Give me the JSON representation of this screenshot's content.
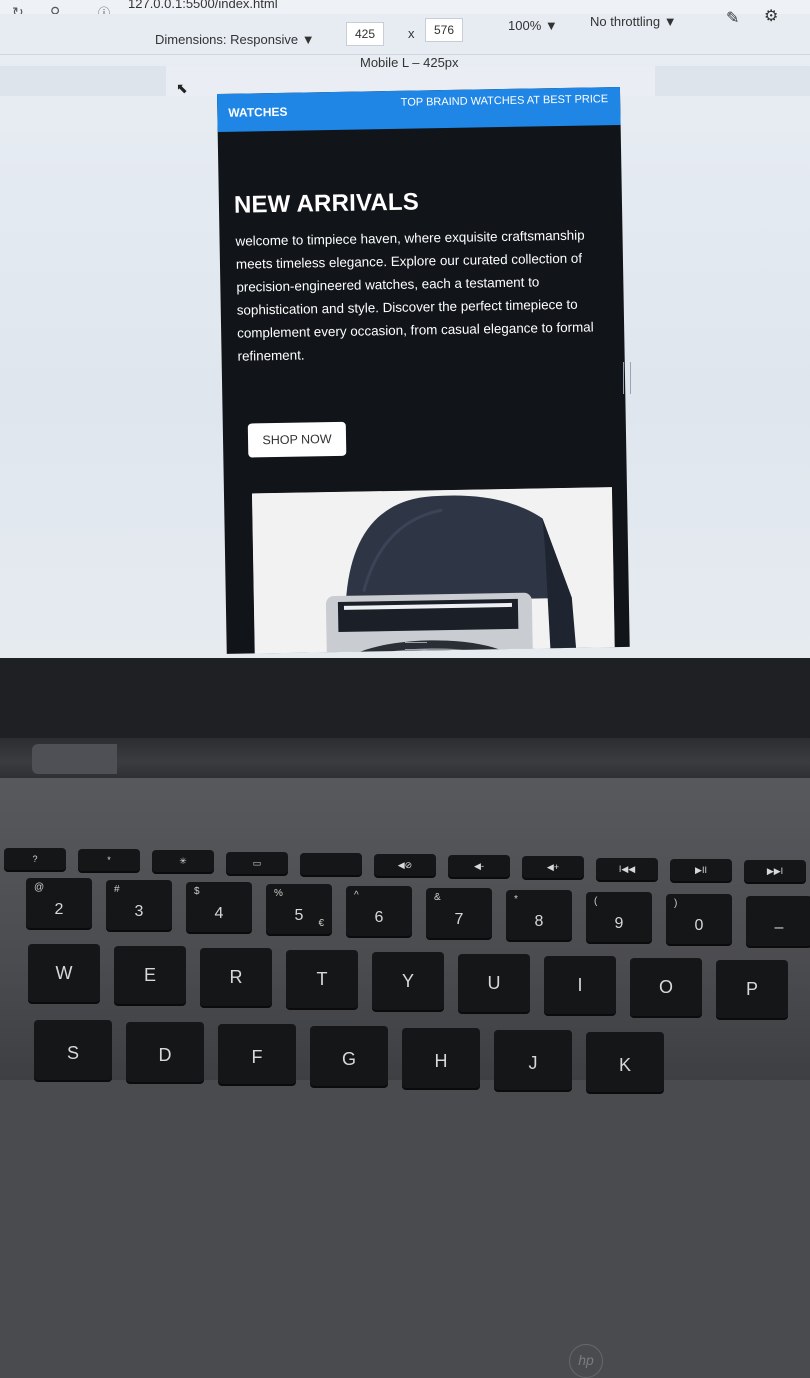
{
  "browser": {
    "url": "127.0.0.1:5500/index.html",
    "dimensions_label": "Dimensions: Responsive",
    "width_value": "425",
    "times": "x",
    "height_value": "576",
    "zoom": "100%",
    "throttling": "No throttling",
    "ruler_label": "Mobile L – 425px"
  },
  "site": {
    "brand": "WATCHES",
    "nav_link": "TOP BRAIND WATCHES AT BEST PRICE",
    "hero_title": "NEW ARRIVALS",
    "hero_text": "welcome to timpiece haven, where exquisite craftsmanship meets timeless elegance. Explore our curated collection of precision-engineered watches, each a testament to sophistication and style. Discover the perfect timepiece to complement every occasion, from casual elegance to formal refinement.",
    "cta_label": "SHOP NOW",
    "accent_color": "#1f86e6",
    "background_color": "#111418"
  },
  "laptop": {
    "logo": "hp",
    "fn_keys": [
      "?",
      "*",
      "✳",
      "▭",
      "",
      "◀⊘",
      "◀-",
      "◀+",
      "I◀◀",
      "▶II",
      "▶▶I"
    ],
    "num_row": [
      {
        "main": "2",
        "top": "@"
      },
      {
        "main": "3",
        "top": "#"
      },
      {
        "main": "4",
        "top": "$"
      },
      {
        "main": "5",
        "top": "%",
        "alt": "€"
      },
      {
        "main": "6",
        "top": "^"
      },
      {
        "main": "7",
        "top": "&"
      },
      {
        "main": "8",
        "top": "*"
      },
      {
        "main": "9",
        "top": "("
      },
      {
        "main": "0",
        "top": ")"
      },
      {
        "main": "–",
        "top": ""
      }
    ],
    "qwerty_row": [
      "W",
      "E",
      "R",
      "T",
      "Y",
      "U",
      "I",
      "O",
      "P"
    ],
    "home_row": [
      "S",
      "D",
      "F",
      "G",
      "H",
      "J",
      "K"
    ]
  }
}
